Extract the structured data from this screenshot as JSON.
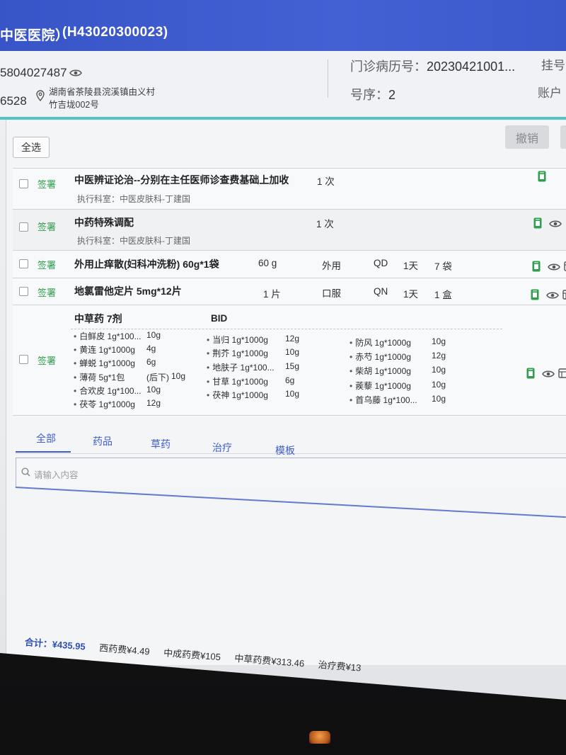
{
  "header": {
    "hospital_name": "中医医院）",
    "hospital_code": "(H43020300023)"
  },
  "patient": {
    "phone": "5804027487",
    "id_tail": "6528",
    "address_line1": "湖南省茶陵县浣溪镇由义村",
    "address_line2": "竹吉垅002号",
    "record_label": "门诊病历号：",
    "record_value": "20230421001...",
    "registration_label": "挂号",
    "queue_label": "号序：",
    "queue_value": "2",
    "account_label": "账户"
  },
  "toolbar": {
    "select_all_label": "全选",
    "undo_label": "撤销"
  },
  "orders": [
    {
      "sign": "签署",
      "name": "中医辨证论治--分别在主任医师诊查费基础上加收",
      "qty": "1 次",
      "dept": "执行科室：中医皮肤科-丁建国"
    },
    {
      "sign": "签署",
      "name": "中药特殊调配",
      "qty": "1 次",
      "dept": "执行科室：中医皮肤科-丁建国"
    },
    {
      "sign": "签署",
      "name": "外用止痒散(妇科冲洗粉) 60g*1袋",
      "dose": "60 g",
      "route": "外用",
      "frequency": "QD",
      "days": "1天",
      "qty": "7 袋"
    },
    {
      "sign": "签署",
      "name": "地氯雷他定片 5mg*12片",
      "dose": "1 片",
      "route": "口服",
      "frequency": "QN",
      "days": "1天",
      "qty": "1 盒"
    }
  ],
  "herbal": {
    "sign": "签署",
    "title": "中草药 7剂",
    "frequency": "BID",
    "columns": [
      [
        {
          "name": "白鲜皮 1g*100...",
          "dose": "10g"
        },
        {
          "name": "黄连 1g*1000g",
          "dose": "4g"
        },
        {
          "name": "蝉蜕 1g*1000g",
          "dose": "6g"
        },
        {
          "name": "薄荷 5g*1包",
          "note": "(后下)",
          "dose": "10g"
        },
        {
          "name": "合欢皮 1g*100...",
          "dose": "10g"
        },
        {
          "name": "茯苓 1g*1000g",
          "dose": "12g"
        }
      ],
      [
        {
          "name": "当归 1g*1000g",
          "dose": "12g"
        },
        {
          "name": "荆芥 1g*1000g",
          "dose": "10g"
        },
        {
          "name": "地肤子 1g*100...",
          "dose": "15g"
        },
        {
          "name": "甘草 1g*1000g",
          "dose": "6g"
        },
        {
          "name": "茯神 1g*1000g",
          "dose": "10g"
        }
      ],
      [
        {
          "name": "防风 1g*1000g",
          "dose": "10g"
        },
        {
          "name": "赤芍 1g*1000g",
          "dose": "12g"
        },
        {
          "name": "柴胡 1g*1000g",
          "dose": "10g"
        },
        {
          "name": "蒺藜 1g*1000g",
          "dose": "10g"
        },
        {
          "name": "首乌藤 1g*100...",
          "dose": "10g"
        }
      ]
    ]
  },
  "tabs": [
    {
      "label": "全部",
      "active": true
    },
    {
      "label": "药品"
    },
    {
      "label": "草药"
    },
    {
      "label": "治疗"
    },
    {
      "label": "模板"
    }
  ],
  "search": {
    "placeholder": "请输入内容"
  },
  "footer": {
    "total_label": "合计：",
    "total_value": "¥435.95",
    "fees": [
      {
        "label": "西药费",
        "value": "¥4.49"
      },
      {
        "label": "中成药费",
        "value": "¥105"
      },
      {
        "label": "中草药费",
        "value": "¥313.46"
      },
      {
        "label": "治疗费",
        "value": "¥13"
      }
    ]
  },
  "icons": {
    "patient": [
      "eye-icon",
      "location-pin-icon"
    ],
    "row_actions": [
      "prescription-icon",
      "eye-icon",
      "table-icon"
    ],
    "search": "search-icon"
  },
  "colors": {
    "header_blue": "#3f5bd0",
    "sign_green": "#2f9e4f",
    "accent_teal": "#52c4c1",
    "total_blue": "#2d4fb8"
  }
}
